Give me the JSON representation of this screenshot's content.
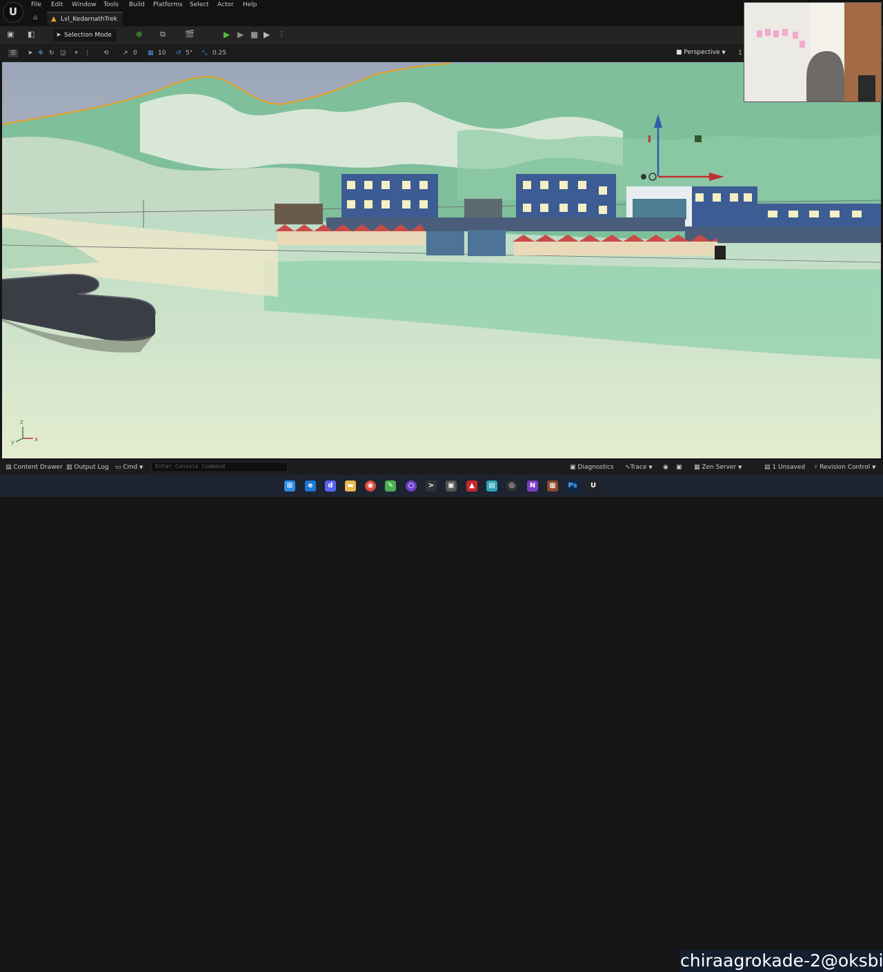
{
  "menu": [
    "File",
    "Edit",
    "Window",
    "Tools",
    "Build",
    "Platforms",
    "Select",
    "Actor",
    "Help"
  ],
  "document_tab": "Lvl_KedarnathTrek",
  "toolbar": {
    "selection_mode": "Selection Mode"
  },
  "viewport_toolbar": {
    "rotate_snap": "0",
    "grid_snap": "10",
    "angle_snap": "5°",
    "scale_snap": "0.25",
    "view_mode": "Perspective",
    "clipped_value": "1"
  },
  "axis_labels": {
    "z": "z",
    "x": "x",
    "y": "y"
  },
  "status": {
    "content_drawer": "Content Drawer",
    "output_log": "Output Log",
    "cmd": "Cmd",
    "console_placeholder": "Enter Console Command",
    "diagnostics": "Diagnostics",
    "trace": "Trace",
    "zen_server": "Zen Server",
    "unsaved": "1 Unsaved",
    "revision_control": "Revision Control"
  },
  "watermark": "chiraagrokade-2@oksbi",
  "colors": {
    "accent_orange": "#e8a020",
    "play_green": "#4fbf3a",
    "building_blue": "#3d5c93",
    "roof_red": "#c94a48"
  }
}
